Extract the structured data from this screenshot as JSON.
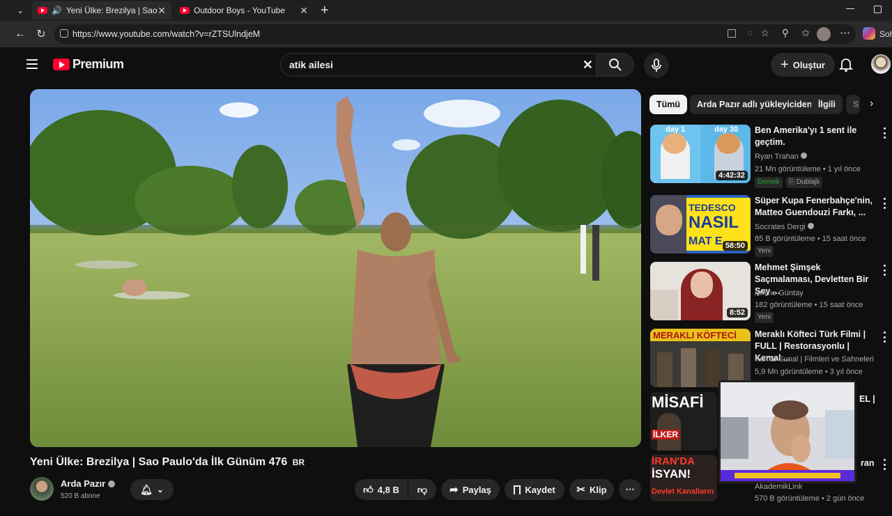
{
  "browser": {
    "tabs": [
      {
        "title": "Yeni Ülke: Brezilya | Sao Paulo'da",
        "active": true
      },
      {
        "title": "Outdoor Boys - YouTube",
        "active": false
      }
    ],
    "url": "https://www.youtube.com/watch?v=rZTSUlndjeM",
    "profile_label": "Soh"
  },
  "masthead": {
    "logo_text": "Premium",
    "search_value": "atik ailesi",
    "create_label": "Oluştur"
  },
  "video": {
    "title": "Yeni Ülke: Brezilya | Sao Paulo'da İlk Günüm 476",
    "title_suffix": "BR",
    "channel": "Arda Pazır",
    "subscribers": "520 B abone",
    "likes": "4,8 B",
    "share_label": "Paylaş",
    "save_label": "Kaydet",
    "clip_label": "Klip"
  },
  "chips": [
    "Tümü",
    "Arda Pazır adlı yükleyiciden",
    "İlgili",
    "S"
  ],
  "recommendations": [
    {
      "title": "Ben Amerika'yı 1 sent ile geçtim.",
      "channel": "Ryan Trahan",
      "verified": true,
      "meta": "21 Mn görüntüleme • 1 yıl önce",
      "duration": "4:42:32",
      "badges": [
        "Demek",
        "Dublajlı"
      ],
      "thumb_text_1": "day 1",
      "thumb_text_2": "day 30"
    },
    {
      "title": "Süper Kupa Fenerbahçe'nin, Matteo Guendouzi Farkı, ...",
      "channel": "Socrates Dergi",
      "verified": true,
      "meta": "85 B görüntüleme • 15 saat önce",
      "duration": "58:50",
      "badges": [
        "Yeni"
      ],
      "thumb_text_1": "TEDESCO",
      "thumb_text_2": "NASIL",
      "thumb_text_3": "MAT E"
    },
    {
      "title": "Mehmet Şimşek Saçmalaması, Devletten Bir Şey ...",
      "channel": "Amine Güntay",
      "verified": false,
      "meta": "182 görüntüleme • 15 saat önce",
      "duration": "8:52",
      "badges": [
        "Yeni"
      ]
    },
    {
      "title": "Meraklı Köfteci Türk Filmi | FULL | Restorasyonlu | Kemal ...",
      "channel": "Kemal Sunal | Filmleri ve Sahneleri",
      "verified": false,
      "meta": "5,9 Mn görüntüleme • 3 yıl önce",
      "duration": "",
      "badges": [],
      "thumb_text_1": "MERAKLI KÖFTECİ"
    },
    {
      "title": "EL |",
      "channel": "",
      "verified": false,
      "meta": "",
      "duration": "",
      "badges": [],
      "thumb_text_1": "MİSAFİ",
      "thumb_text_2": "İLKER"
    },
    {
      "title": "ran",
      "channel": "AkademikLink",
      "verified": false,
      "meta": "570 B görüntüleme • 2 gün önce",
      "duration": "",
      "badges": [],
      "thumb_text_1": "İRAN'DA",
      "thumb_text_2": "İSYAN!",
      "thumb_text_3": "Devlet Kanalların"
    }
  ],
  "colors": {
    "accent": "#ff0033",
    "background": "#0f0f0f",
    "new_badge": "#3ea6ff",
    "demek_badge": "#2ba640"
  }
}
